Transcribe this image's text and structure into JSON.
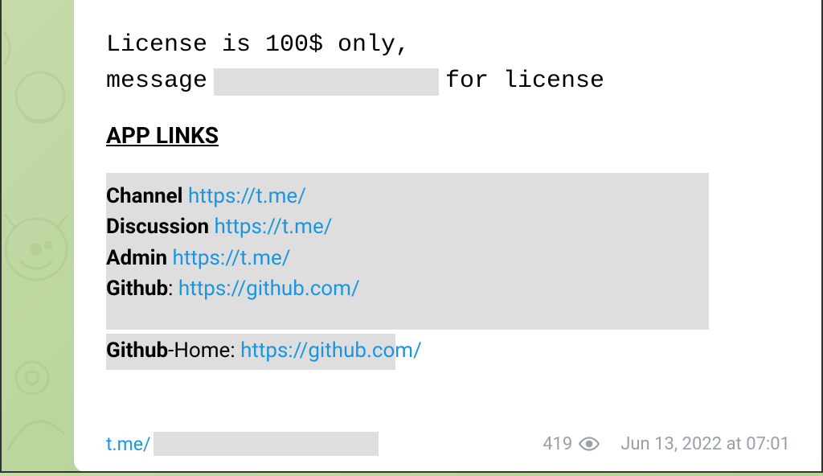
{
  "license": {
    "line1": "License is 100$ only,",
    "line2_prefix": "message",
    "line2_suffix": "for license"
  },
  "section_heading": "APP LINKS",
  "links": [
    {
      "label": "Channel",
      "sep": " ",
      "url": "https://t.me/"
    },
    {
      "label": "Discussion",
      "sep": " ",
      "url": "https://t.me/"
    },
    {
      "label": "Admin",
      "sep": " ",
      "url": "https://t.me/"
    },
    {
      "label": "Github",
      "sep": ": ",
      "url": "https://github.com/"
    },
    {
      "label": "Github",
      "label_suffix": "-Home",
      "sep": ": ",
      "url": "https://github.com/"
    }
  ],
  "footer": {
    "source_link": "t.me/",
    "view_count": "419",
    "timestamp": "Jun 13, 2022 at 07:01"
  }
}
